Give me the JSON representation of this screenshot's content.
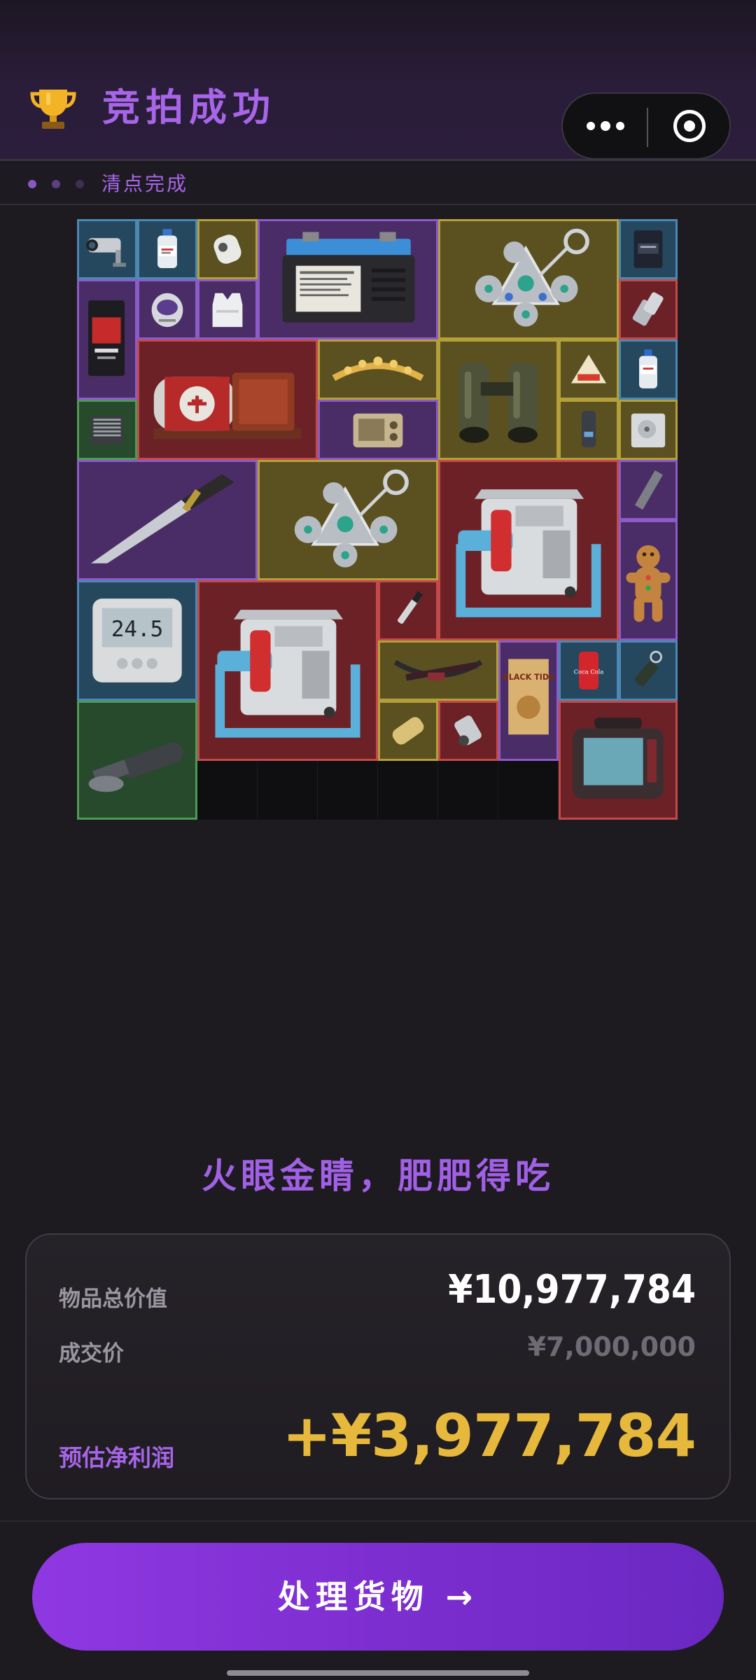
{
  "header": {
    "title": "竞拍成功",
    "trophy_icon": "trophy-icon",
    "capsule": {
      "more_icon": "more-dots-icon",
      "close_icon": "target-close-icon"
    }
  },
  "status": {
    "text": "清点完成",
    "progress_dots": 3
  },
  "grid": {
    "items": [
      {
        "name": "security-camera",
        "rarity": "blue"
      },
      {
        "name": "saline-bottle",
        "rarity": "blue"
      },
      {
        "name": "round-sensor",
        "rarity": "gold"
      },
      {
        "name": "car-battery",
        "rarity": "purple"
      },
      {
        "name": "crystal-pendant",
        "rarity": "gold"
      },
      {
        "name": "coffee-bag",
        "rarity": "blue"
      },
      {
        "name": "snack-pack",
        "rarity": "purple"
      },
      {
        "name": "hockey-mask",
        "rarity": "purple"
      },
      {
        "name": "body-armor-vest",
        "rarity": "purple"
      },
      {
        "name": "metal-connectors",
        "rarity": "red"
      },
      {
        "name": "medical-device",
        "rarity": "red"
      },
      {
        "name": "gold-tiara",
        "rarity": "gold"
      },
      {
        "name": "binoculars",
        "rarity": "gold"
      },
      {
        "name": "cheese-wedge",
        "rarity": "gold"
      },
      {
        "name": "water-bottle",
        "rarity": "blue"
      },
      {
        "name": "cpu-cooler",
        "rarity": "green"
      },
      {
        "name": "radio",
        "rarity": "purple"
      },
      {
        "name": "usb-stick",
        "rarity": "gold"
      },
      {
        "name": "hard-drive",
        "rarity": "gold"
      },
      {
        "name": "combat-knife",
        "rarity": "purple"
      },
      {
        "name": "crystal-pendant",
        "rarity": "gold"
      },
      {
        "name": "pump-machine",
        "rarity": "red"
      },
      {
        "name": "memory-stick",
        "rarity": "purple"
      },
      {
        "name": "gingerbread-man",
        "rarity": "purple"
      },
      {
        "name": "digital-thermometer",
        "rarity": "blue"
      },
      {
        "name": "pump-machine",
        "rarity": "red"
      },
      {
        "name": "syringe-pen",
        "rarity": "red"
      },
      {
        "name": "crossbow",
        "rarity": "gold"
      },
      {
        "name": "magazine",
        "rarity": "purple"
      },
      {
        "name": "soda-can",
        "rarity": "blue"
      },
      {
        "name": "led-flashlight",
        "rarity": "blue"
      },
      {
        "name": "angle-grinder",
        "rarity": "green"
      },
      {
        "name": "capacitor",
        "rarity": "gold"
      },
      {
        "name": "spark-plug",
        "rarity": "red"
      },
      {
        "name": "field-terminal",
        "rarity": "red"
      }
    ],
    "labels": {
      "thermometer_reading": "24.5",
      "magazine_title": "BLACK TIDE",
      "can_brand": "Coca Cola"
    }
  },
  "slogan": "火眼金睛，肥肥得吃",
  "summary": {
    "total_label": "物品总价值",
    "total_value": "¥10,977,784",
    "deal_label": "成交价",
    "deal_value": "¥7,000,000",
    "profit_label": "预估净利润",
    "profit_value": "+¥3,977,784"
  },
  "cta": {
    "label": "处理货物 →"
  },
  "colors": {
    "accent": "#a765e8",
    "profit": "#e6b93c",
    "rarity_blue": "#4c88b4",
    "rarity_purple": "#8c5bc8",
    "rarity_gold": "#b4a03a",
    "rarity_red": "#c44a4a",
    "rarity_green": "#4d9c55"
  }
}
